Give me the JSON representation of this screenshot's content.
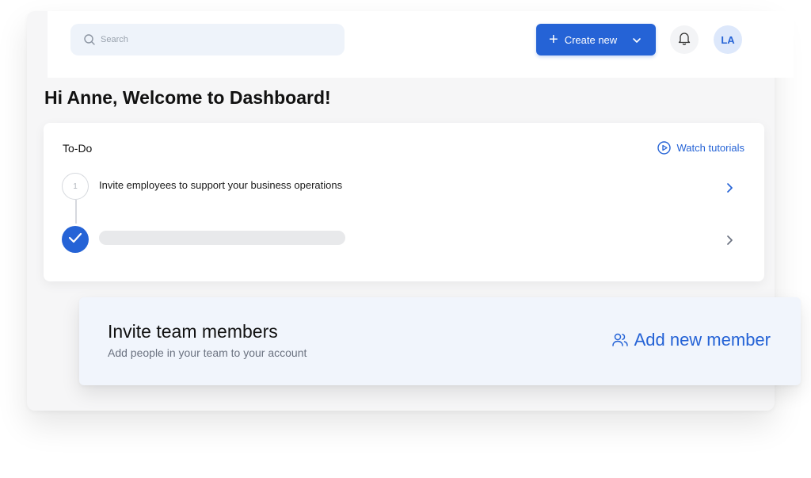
{
  "header": {
    "search": {
      "placeholder": "Search"
    },
    "create_button": {
      "label": "Create new"
    },
    "notifications": {
      "icon": "bell-icon"
    },
    "user": {
      "initials": "LA"
    }
  },
  "main": {
    "greeting": "Hi Anne, Welcome to Dashboard!",
    "todo": {
      "title": "To-Do",
      "watch_tutorials": "Watch tutorials",
      "steps": [
        {
          "number": "1",
          "text": "Invite employees to support your business operations",
          "status": "pending"
        },
        {
          "number": "",
          "text": "",
          "status": "done"
        }
      ]
    },
    "invite": {
      "title": "Invite team members",
      "subtitle": "Add people in your team to your account",
      "action": "Add new member"
    }
  },
  "colors": {
    "accent": "#2563d6",
    "search_bg": "#eef3fa",
    "invite_bg": "#f1f5fc"
  }
}
